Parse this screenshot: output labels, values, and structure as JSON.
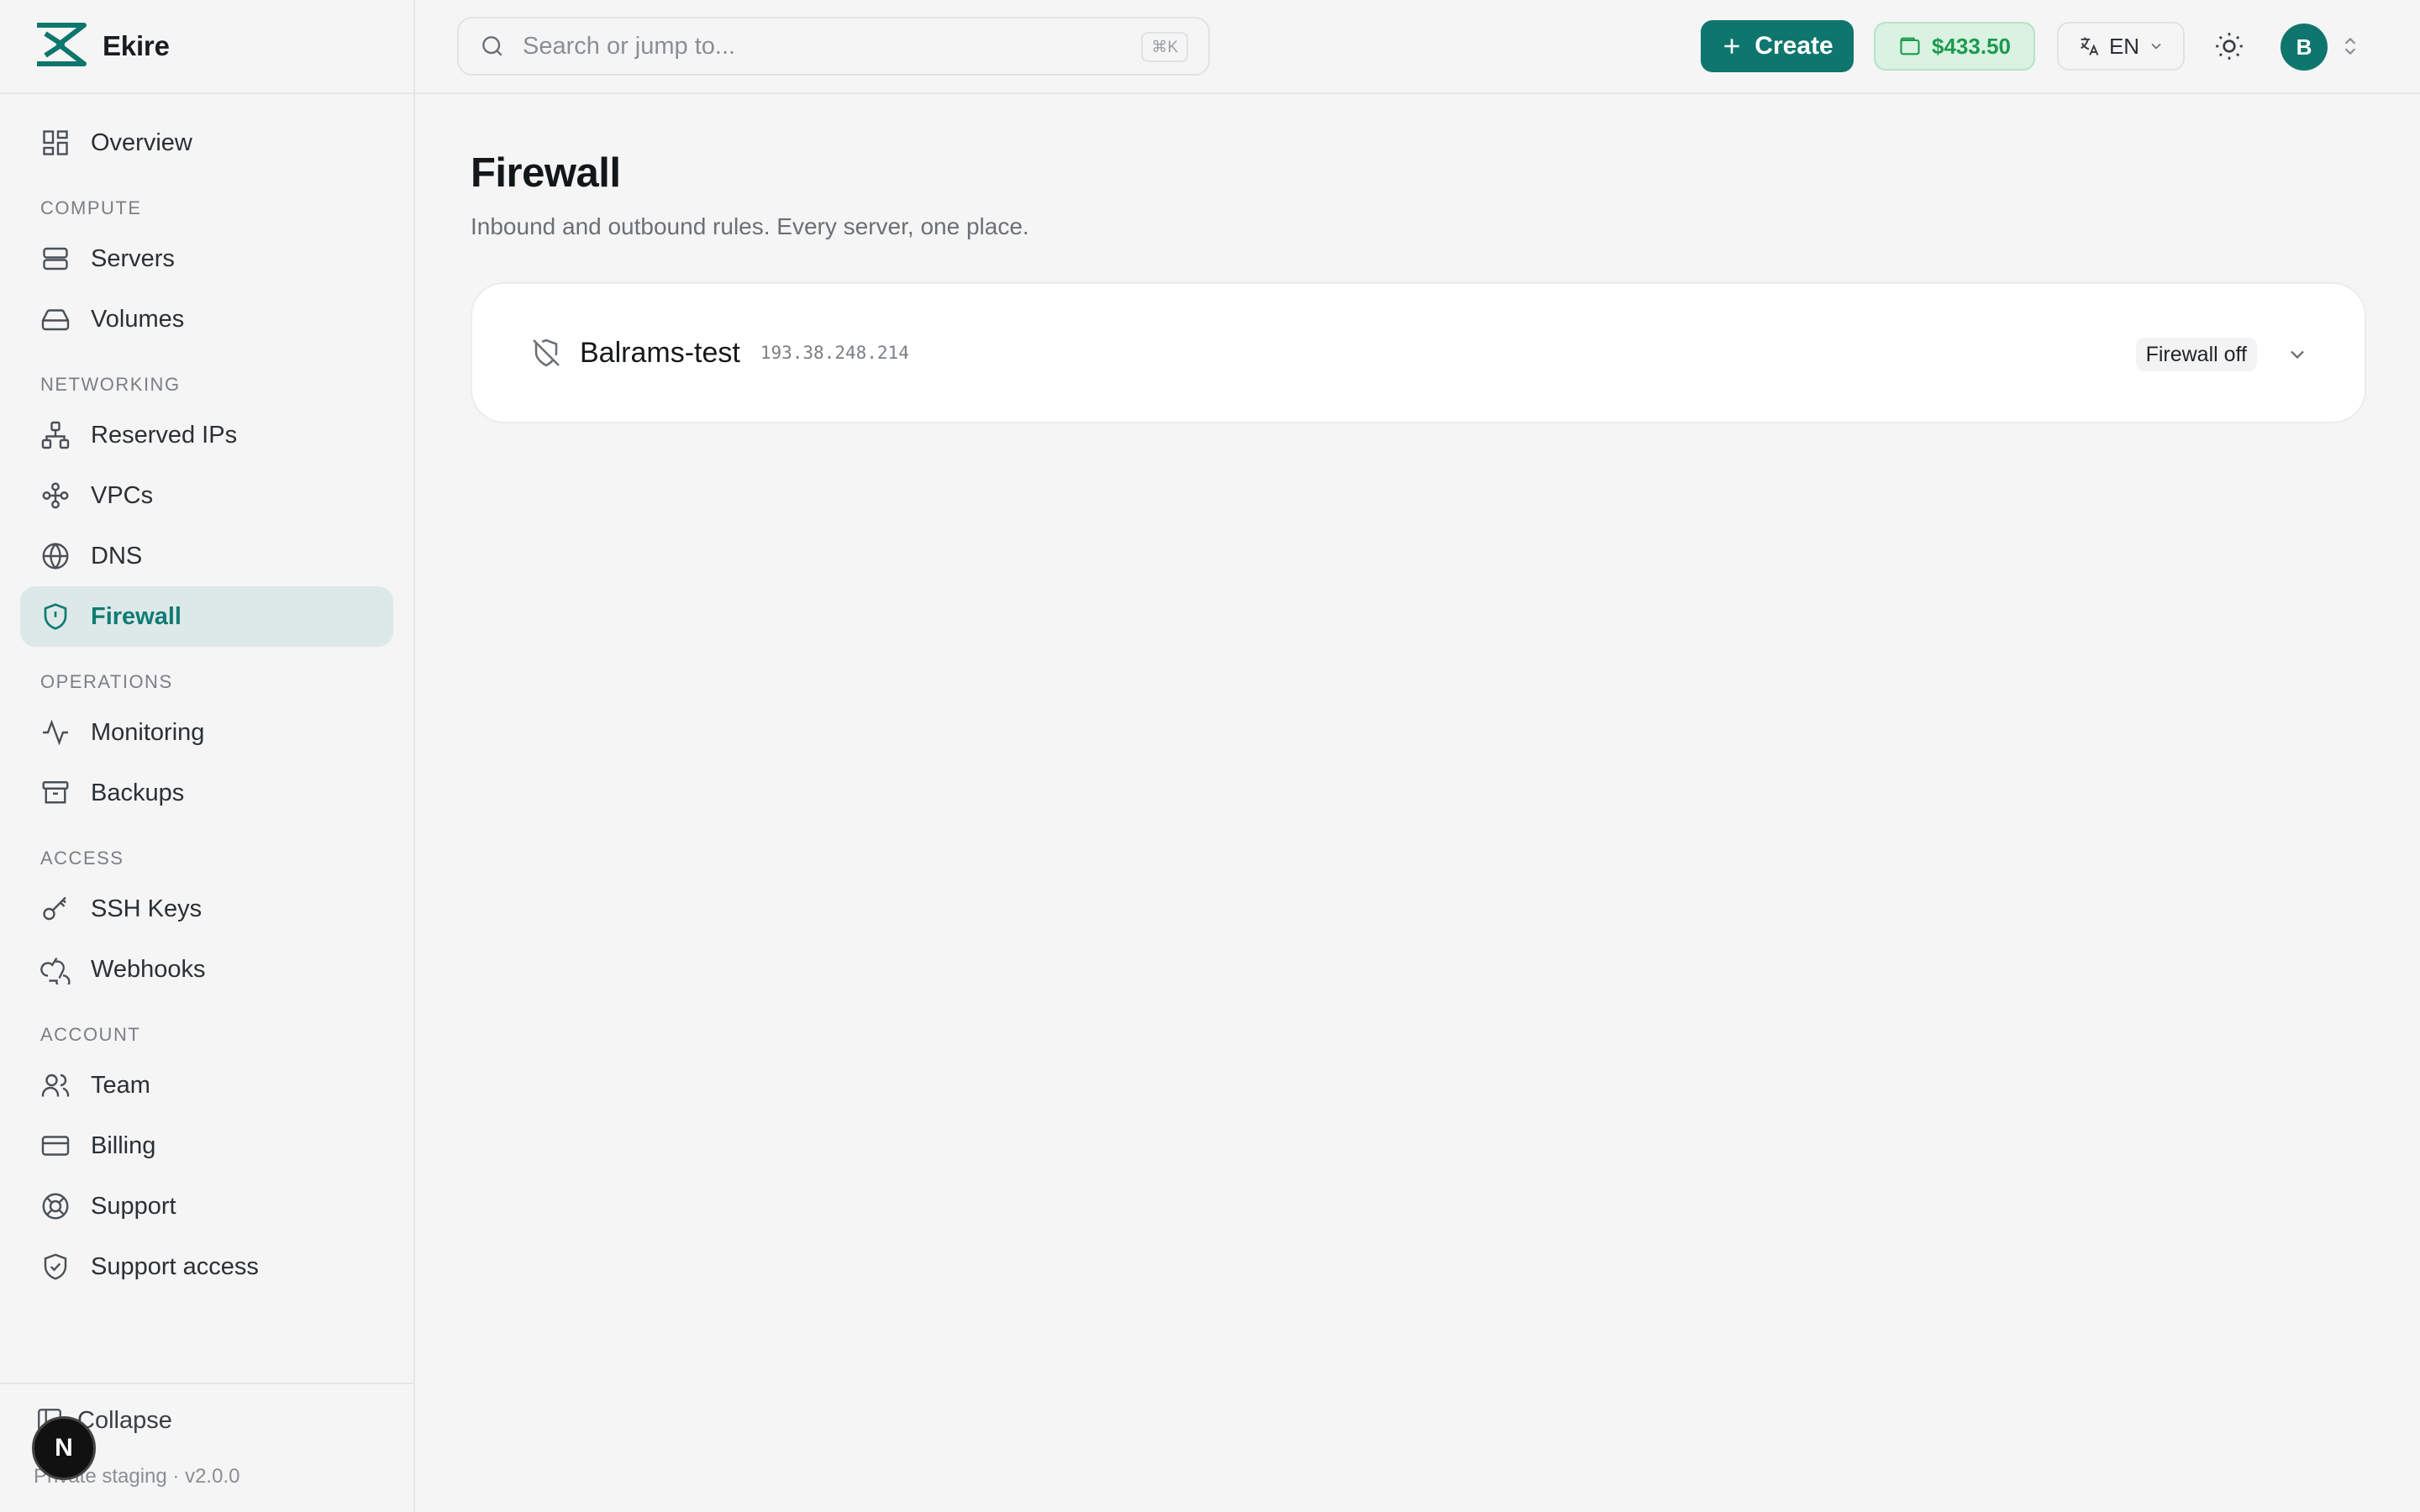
{
  "brand": {
    "name": "Ekire"
  },
  "search": {
    "placeholder": "Search or jump to...",
    "shortcut": "⌘K"
  },
  "topbar": {
    "create_label": "Create",
    "balance": "$433.50",
    "language": "EN",
    "avatar_initial": "B"
  },
  "sidebar": {
    "overview": "Overview",
    "sections": {
      "compute": "COMPUTE",
      "networking": "NETWORKING",
      "operations": "OPERATIONS",
      "access": "ACCESS",
      "account": "ACCOUNT"
    },
    "items": {
      "servers": "Servers",
      "volumes": "Volumes",
      "reserved_ips": "Reserved IPs",
      "vpcs": "VPCs",
      "dns": "DNS",
      "firewall": "Firewall",
      "monitoring": "Monitoring",
      "backups": "Backups",
      "ssh_keys": "SSH Keys",
      "webhooks": "Webhooks",
      "team": "Team",
      "billing": "Billing",
      "support": "Support",
      "support_access": "Support access"
    },
    "collapse_label": "Collapse",
    "version": "Private staging · v2.0.0",
    "active_item": "firewall"
  },
  "main": {
    "title": "Firewall",
    "subtitle": "Inbound and outbound rules. Every server, one place.",
    "servers": [
      {
        "name": "Balrams-test",
        "ip": "193.38.248.214",
        "status": "Firewall off"
      }
    ]
  },
  "dev_badge": {
    "letter": "N"
  },
  "colors": {
    "accent": "#0f766e",
    "active_bg": "#dde9e8",
    "balance_bg": "#d9f2e2",
    "balance_text": "#1d9a4e"
  }
}
